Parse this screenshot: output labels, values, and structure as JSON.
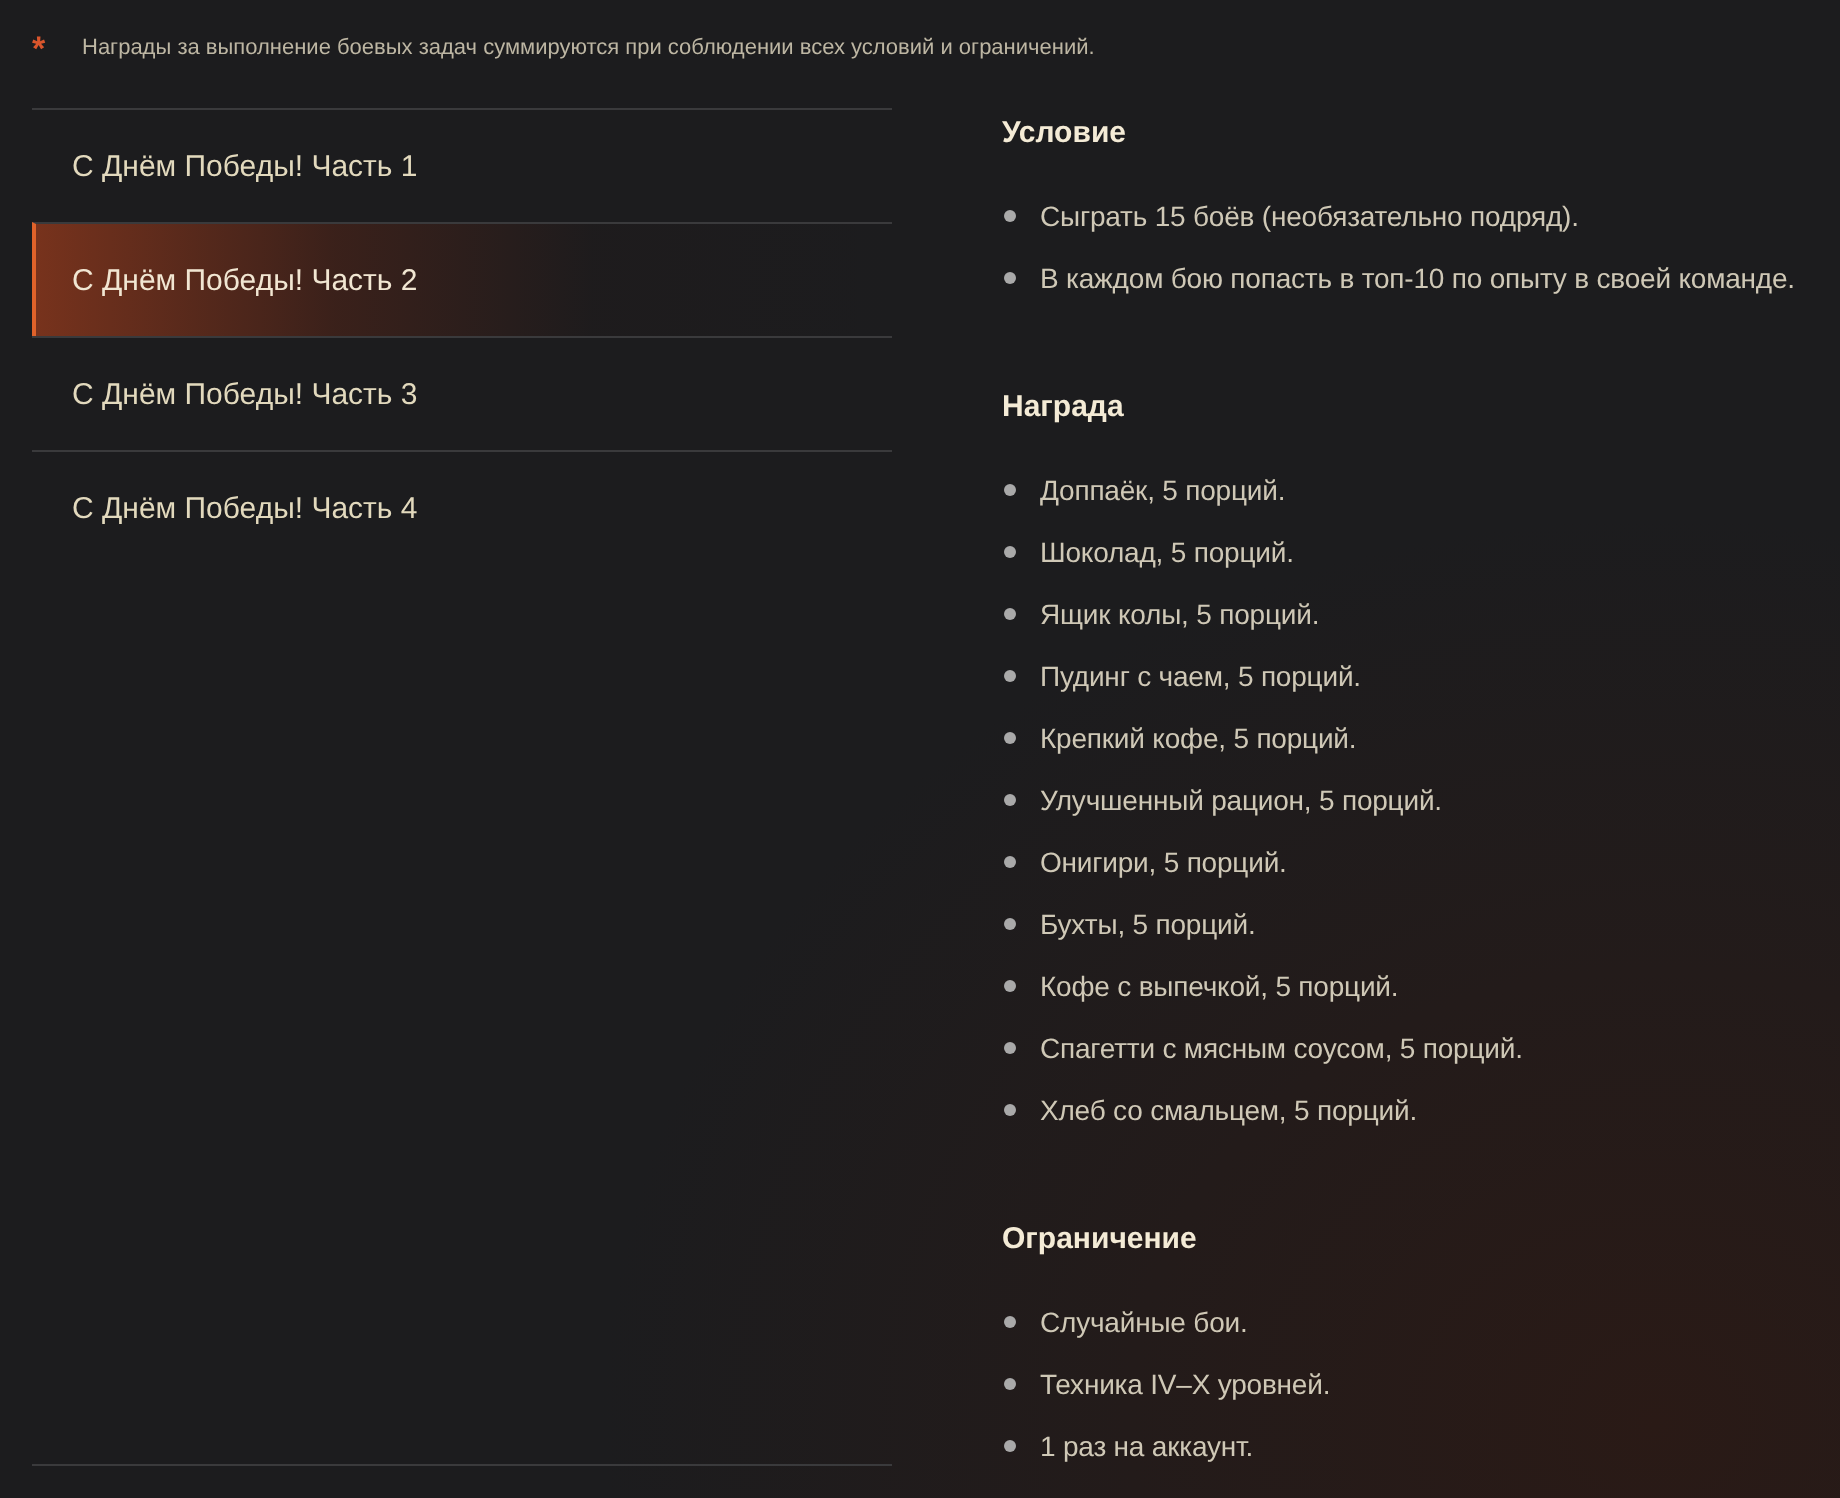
{
  "note": {
    "mark": "*",
    "text": "Награды за выполнение боевых задач суммируются при соблюдении всех условий и ограничений."
  },
  "tabs": [
    {
      "label": "С Днём Победы! Часть 1",
      "selected": false
    },
    {
      "label": "С Днём Победы! Часть 2",
      "selected": true
    },
    {
      "label": "С Днём Победы! Часть 3",
      "selected": false
    },
    {
      "label": "С Днём Победы! Часть 4",
      "selected": false
    }
  ],
  "sections": [
    {
      "title": "Условие",
      "items": [
        "Сыграть 15 боёв (необязательно подряд).",
        "В каждом бою попасть в топ-10 по опыту в своей команде."
      ]
    },
    {
      "title": "Награда",
      "items": [
        "Доппаёк, 5 порций.",
        "Шоколад, 5 порций.",
        "Ящик колы, 5 порций.",
        "Пудинг с чаем, 5 порций.",
        "Крепкий кофе, 5 порций.",
        "Улучшенный рацион, 5 порций.",
        "Онигири, 5 порций.",
        "Бухты, 5 порций.",
        "Кофе с выпечкой, 5 порций.",
        "Спагетти с мясным соусом, 5 порций.",
        "Хлеб со смальцем, 5 порций."
      ]
    },
    {
      "title": "Ограничение",
      "items": [
        "Случайные бои.",
        "Техника IV–X уровней.",
        "1 раз на аккаунт."
      ]
    }
  ]
}
